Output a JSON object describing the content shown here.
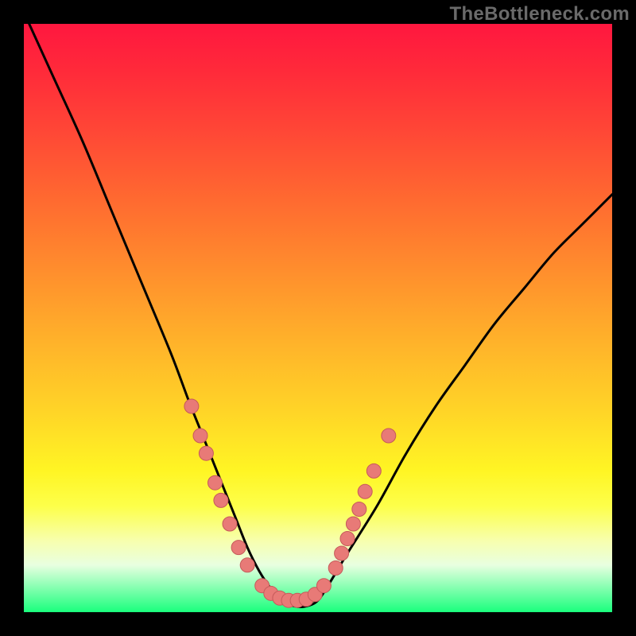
{
  "watermark": "TheBottleneck.com",
  "colors": {
    "background": "#000000",
    "curve": "#000000",
    "point_fill": "#e87a77",
    "point_stroke": "#c65a5a"
  },
  "chart_data": {
    "type": "line",
    "title": "",
    "xlabel": "",
    "ylabel": "",
    "xlim": [
      0,
      100
    ],
    "ylim": [
      0,
      100
    ],
    "note": "Values are approximate pixel-normalized percentages read from the figure (0 = left/bottom, 100 = right/top). The curve is a V-shaped bottleneck curve; marked points sit on the lower portion of the curve.",
    "series": [
      {
        "name": "bottleneck-curve",
        "x": [
          0,
          5,
          10,
          15,
          20,
          25,
          28,
          30,
          32,
          34,
          36,
          38,
          40,
          42,
          44,
          46,
          48,
          50,
          52,
          55,
          60,
          65,
          70,
          75,
          80,
          85,
          90,
          95,
          100
        ],
        "y": [
          102,
          91,
          80,
          68,
          56,
          44,
          36,
          31,
          26,
          21,
          16,
          11,
          7,
          4,
          2,
          1,
          1,
          2,
          5,
          10,
          18,
          27,
          35,
          42,
          49,
          55,
          61,
          66,
          71
        ]
      }
    ],
    "points": [
      {
        "x": 28.5,
        "y": 35.0
      },
      {
        "x": 30.0,
        "y": 30.0
      },
      {
        "x": 31.0,
        "y": 27.0
      },
      {
        "x": 32.5,
        "y": 22.0
      },
      {
        "x": 33.5,
        "y": 19.0
      },
      {
        "x": 35.0,
        "y": 15.0
      },
      {
        "x": 36.5,
        "y": 11.0
      },
      {
        "x": 38.0,
        "y": 8.0
      },
      {
        "x": 40.5,
        "y": 4.5
      },
      {
        "x": 42.0,
        "y": 3.2
      },
      {
        "x": 43.5,
        "y": 2.4
      },
      {
        "x": 45.0,
        "y": 2.0
      },
      {
        "x": 46.5,
        "y": 2.0
      },
      {
        "x": 48.0,
        "y": 2.2
      },
      {
        "x": 49.5,
        "y": 3.0
      },
      {
        "x": 51.0,
        "y": 4.5
      },
      {
        "x": 53.0,
        "y": 7.5
      },
      {
        "x": 54.0,
        "y": 10.0
      },
      {
        "x": 55.0,
        "y": 12.5
      },
      {
        "x": 56.0,
        "y": 15.0
      },
      {
        "x": 57.0,
        "y": 17.5
      },
      {
        "x": 58.0,
        "y": 20.5
      },
      {
        "x": 59.5,
        "y": 24.0
      },
      {
        "x": 62.0,
        "y": 30.0
      }
    ]
  }
}
